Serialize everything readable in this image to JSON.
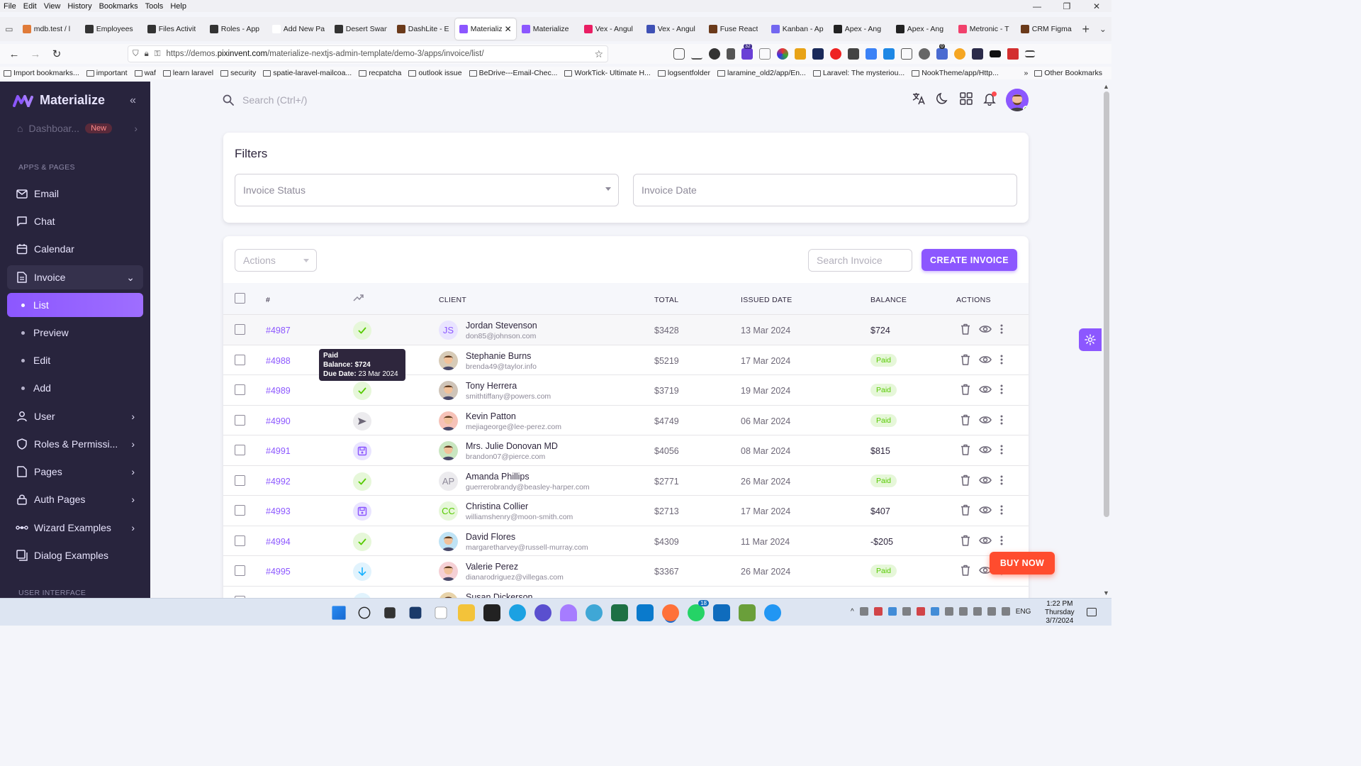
{
  "browser": {
    "menu": [
      "File",
      "Edit",
      "View",
      "History",
      "Bookmarks",
      "Tools",
      "Help"
    ],
    "tabs": [
      {
        "label": "mdb.test / l",
        "color": "#e07b39"
      },
      {
        "label": "Employees",
        "color": "#333333"
      },
      {
        "label": "Files Activit",
        "color": "#333333"
      },
      {
        "label": "Roles - App",
        "color": "#333333"
      },
      {
        "label": "Add New Page",
        "color": "#ffffff"
      },
      {
        "label": "Desert Swan",
        "color": "#333333"
      },
      {
        "label": "DashLite - E",
        "color": "#6b3a1a"
      },
      {
        "label": "Materializ",
        "color": "#8c57ff",
        "active": true
      },
      {
        "label": "Materialize",
        "color": "#8c57ff"
      },
      {
        "label": "Vex - Angul",
        "color": "#e91e63"
      },
      {
        "label": "Vex - Angul",
        "color": "#3f51b5"
      },
      {
        "label": "Fuse React",
        "color": "#6b3a1a"
      },
      {
        "label": "Kanban - Ap",
        "color": "#7367f0"
      },
      {
        "label": "Apex - Ang",
        "color": "#222222"
      },
      {
        "label": "Apex - Ang",
        "color": "#222222"
      },
      {
        "label": "Metronic - T",
        "color": "#f1416c"
      },
      {
        "label": "CRM Figma",
        "color": "#6b3a1a"
      }
    ],
    "url_prefix": "https://demos.",
    "url_domain": "pixinvent.com",
    "url_path": "/materialize-nextjs-admin-template/demo-3/apps/invoice/list/",
    "bookmarks": [
      "Import bookmarks...",
      "important",
      "waf",
      "learn laravel",
      "security",
      "spatie-laravel-mailcoa...",
      "recpatcha",
      "outlook issue",
      "BeDrive---Email-Chec...",
      "WorkTick- Ultimate H...",
      "logsentfolder",
      "laramine_old2/app/En...",
      "Laravel: The mysteriou...",
      "NookTheme/app/Http..."
    ],
    "other_bookmarks": "Other Bookmarks",
    "ext_badge_1": "32",
    "ext_badge_2": "0"
  },
  "sidebar": {
    "brand": "Materialize",
    "dashboard": "Dashboar...",
    "dashboard_badge": "New",
    "section_apps": "APPS & PAGES",
    "section_ui": "USER INTERFACE",
    "items": [
      {
        "label": "Email",
        "icon": "mail-icon"
      },
      {
        "label": "Chat",
        "icon": "chat-icon"
      },
      {
        "label": "Calendar",
        "icon": "calendar-icon"
      },
      {
        "label": "Invoice",
        "icon": "invoice-icon"
      },
      {
        "label": "User",
        "icon": "user-icon"
      },
      {
        "label": "Roles & Permissi...",
        "icon": "shield-icon"
      },
      {
        "label": "Pages",
        "icon": "pages-icon"
      },
      {
        "label": "Auth Pages",
        "icon": "lock-icon"
      },
      {
        "label": "Wizard Examples",
        "icon": "wizard-icon"
      },
      {
        "label": "Dialog Examples",
        "icon": "dialog-icon"
      }
    ],
    "invoice_sub": [
      "List",
      "Preview",
      "Edit",
      "Add"
    ]
  },
  "topbar": {
    "search_placeholder": "Search (Ctrl+/)"
  },
  "filters": {
    "title": "Filters",
    "status_placeholder": "Invoice Status",
    "date_placeholder": "Invoice Date"
  },
  "list": {
    "actions_placeholder": "Actions",
    "search_placeholder": "Search Invoice",
    "create_label": "CREATE INVOICE",
    "columns": {
      "id": "#",
      "client": "CLIENT",
      "total": "TOTAL",
      "issued": "ISSUED DATE",
      "balance": "BALANCE",
      "actions": "ACTIONS"
    },
    "rows": [
      {
        "id": "#4987",
        "status": "paid",
        "initials": "JS",
        "avatar_color": "#e9e4ff",
        "initials_color": "#8c57ff",
        "name": "Jordan Stevenson",
        "email": "don85@johnson.com",
        "total": "$3428",
        "date": "13 Mar 2024",
        "balance": "$724",
        "paid": false
      },
      {
        "id": "#4988",
        "status": "paid",
        "initials": "",
        "avatar_color": "#d7cbb7",
        "name": "Stephanie Burns",
        "email": "brenda49@taylor.info",
        "total": "$5219",
        "date": "17 Mar 2024",
        "balance": "Paid",
        "paid": true
      },
      {
        "id": "#4989",
        "status": "paid",
        "initials": "",
        "avatar_color": "#cfc4b8",
        "name": "Tony Herrera",
        "email": "smithtiffany@powers.com",
        "total": "$3719",
        "date": "19 Mar 2024",
        "balance": "Paid",
        "paid": true
      },
      {
        "id": "#4990",
        "status": "sent",
        "initials": "",
        "avatar_color": "#f6c2b8",
        "name": "Kevin Patton",
        "email": "mejiageorge@lee-perez.com",
        "total": "$4749",
        "date": "06 Mar 2024",
        "balance": "Paid",
        "paid": true
      },
      {
        "id": "#4991",
        "status": "draft",
        "initials": "",
        "avatar_color": "#c9e6c0",
        "name": "Mrs. Julie Donovan MD",
        "email": "brandon07@pierce.com",
        "total": "$4056",
        "date": "08 Mar 2024",
        "balance": "$815",
        "paid": false
      },
      {
        "id": "#4992",
        "status": "paid",
        "initials": "AP",
        "avatar_color": "#ecebee",
        "initials_color": "#8e8a99",
        "name": "Amanda Phillips",
        "email": "guerrerobrandy@beasley-harper.com",
        "total": "$2771",
        "date": "26 Mar 2024",
        "balance": "Paid",
        "paid": true
      },
      {
        "id": "#4993",
        "status": "draft",
        "initials": "CC",
        "avatar_color": "#e6f7d9",
        "initials_color": "#56ca00",
        "name": "Christina Collier",
        "email": "williamshenry@moon-smith.com",
        "total": "$2713",
        "date": "17 Mar 2024",
        "balance": "$407",
        "paid": false
      },
      {
        "id": "#4994",
        "status": "paid",
        "initials": "",
        "avatar_color": "#bfe3f5",
        "name": "David Flores",
        "email": "margaretharvey@russell-murray.com",
        "total": "$4309",
        "date": "11 Mar 2024",
        "balance": "-$205",
        "paid": false
      },
      {
        "id": "#4995",
        "status": "downloaded",
        "initials": "",
        "avatar_color": "#f5d0d5",
        "name": "Valerie Perez",
        "email": "dianarodriguez@villegas.com",
        "total": "$3367",
        "date": "26 Mar 2024",
        "balance": "Paid",
        "paid": true
      },
      {
        "id": "",
        "status": "",
        "initials": "",
        "avatar_color": "#e8d3a9",
        "name": "Susan Dickerson",
        "email": "",
        "total": "",
        "date": "",
        "balance": "",
        "paid": false
      }
    ],
    "tooltip": {
      "status": "Paid",
      "balance": "Balance: $724",
      "due": "Due Date:",
      "due_value": "23 Mar 2024"
    }
  },
  "buy_now": "BUY NOW",
  "taskbar": {
    "time": "1:22 PM",
    "day": "Thursday",
    "date": "3/7/2024",
    "lang": "ENG",
    "whatsapp_badge": "18"
  },
  "colors": {
    "primary": "#8c57ff",
    "success": "#56ca00",
    "danger": "#ff4c51",
    "sidebar": "#28243d"
  }
}
